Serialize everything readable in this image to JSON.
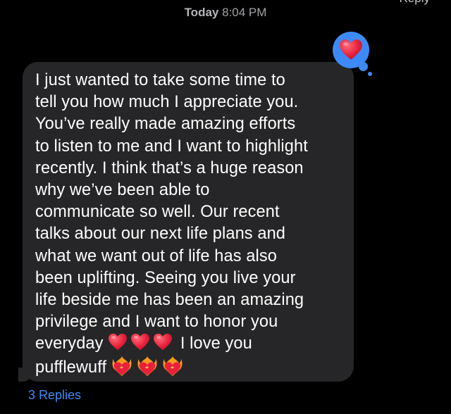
{
  "header": {
    "cutoff_text": "Reply",
    "timestamp_day": "Today",
    "timestamp_time": "8:04 PM"
  },
  "message": {
    "text_main": "I just wanted to take some time to\ntell you how much I appreciate you.\nYou’ve really made amazing efforts\nto listen to me and I want to highlight\nrecently. I think that’s a huge reason\nwhy we’ve been able to\ncommunicate so well. Our recent\ntalks about our next life plans and\nwhat we want out of life has also\nbeen uplifting. Seeing you live your\nlife beside me has been an amazing\nprivilege and I want to honor you\neveryday ",
    "text_love": "I love you",
    "text_nickname": "pufflewuff ",
    "emoji_red_heart": "red-heart-emoji",
    "emoji_heart_on_fire": "heart-on-fire-emoji"
  },
  "tapback": {
    "reaction": "heart-icon",
    "bubble_color": "#3d8af7"
  },
  "replies": {
    "label": "3 Replies"
  },
  "colors": {
    "background": "#000000",
    "bubble": "#262628",
    "accent": "#3d8af7",
    "heart": "#e8203c"
  }
}
